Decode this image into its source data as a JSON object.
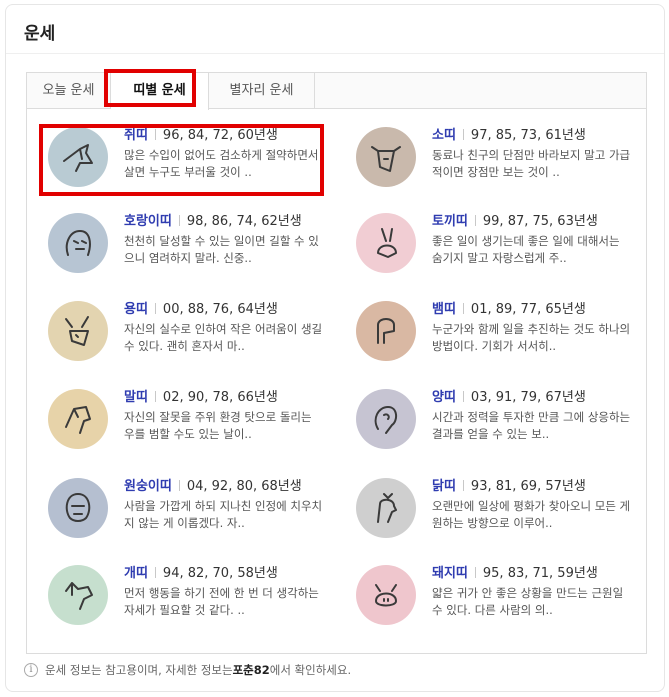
{
  "title": "운세",
  "tabs": [
    {
      "label": "오늘 운세"
    },
    {
      "label": "띠별 운세"
    },
    {
      "label": "별자리 운세"
    }
  ],
  "zodiac": [
    {
      "name": "쥐띠",
      "years": "96, 84, 72, 60년생",
      "desc1": "많은 수입이 없어도 검소하게 절약하면서",
      "desc2": "살면 누구도 부러울 것이 ..",
      "icon": "rat-icon",
      "bg": "#b9cbd3"
    },
    {
      "name": "소띠",
      "years": "97, 85, 73, 61년생",
      "desc1": "동료나 친구의 단점만 바라보지 말고 가급",
      "desc2": "적이면 장점만 보는 것이 ..",
      "icon": "ox-icon",
      "bg": "#c9b9ac"
    },
    {
      "name": "호랑이띠",
      "years": "98, 86, 74, 62년생",
      "desc1": "천천히 달성할 수 있는 일이면 길할 수 있",
      "desc2": "으니 염려하지 말라. 신중..",
      "icon": "tiger-icon",
      "bg": "#b7c5d3"
    },
    {
      "name": "토끼띠",
      "years": "99, 87, 75, 63년생",
      "desc1": "좋은 일이 생기는데 좋은 일에 대해서는",
      "desc2": "숨기지 말고 자랑스럽게 주..",
      "icon": "rabbit-icon",
      "bg": "#f1cdd3"
    },
    {
      "name": "용띠",
      "years": "00, 88, 76, 64년생",
      "desc1": "자신의 실수로 인하여 작은 어려움이 생길",
      "desc2": "수 있다. 괜히 혼자서 마..",
      "icon": "dragon-icon",
      "bg": "#e3d4b0"
    },
    {
      "name": "뱀띠",
      "years": "01, 89, 77, 65년생",
      "desc1": "누군가와 함께 일을 추진하는 것도 하나의",
      "desc2": "방법이다. 기회가 서서히..",
      "icon": "snake-icon",
      "bg": "#d9b8a3"
    },
    {
      "name": "말띠",
      "years": "02, 90, 78, 66년생",
      "desc1": "자신의 잘못을 주위 환경 탓으로 돌리는",
      "desc2": "우를 범할 수도 있는 날이..",
      "icon": "horse-icon",
      "bg": "#e7d3a9"
    },
    {
      "name": "양띠",
      "years": "03, 91, 79, 67년생",
      "desc1": "시간과 정력을 투자한 만큼 그에 상응하는",
      "desc2": "결과를 얻을 수 있는 보..",
      "icon": "sheep-icon",
      "bg": "#c6c4d2"
    },
    {
      "name": "원숭이띠",
      "years": "04, 92, 80, 68년생",
      "desc1": "사람을 가깝게 하되 지나친 인정에 치우치",
      "desc2": "지 않는 게 이롭겠다. 자..",
      "icon": "monkey-icon",
      "bg": "#b5bfd0"
    },
    {
      "name": "닭띠",
      "years": "93, 81, 69, 57년생",
      "desc1": "오랜만에 일상에 평화가 찾아오니 모든 게",
      "desc2": "원하는 방향으로 이루어..",
      "icon": "rooster-icon",
      "bg": "#cfcfcf"
    },
    {
      "name": "개띠",
      "years": "94, 82, 70, 58년생",
      "desc1": "먼저 행동을 하기 전에 한 번 더 생각하는",
      "desc2": "자세가 필요할 것 같다. ..",
      "icon": "dog-icon",
      "bg": "#c6dfce"
    },
    {
      "name": "돼지띠",
      "years": "95, 83, 71, 59년생",
      "desc1": "얇은 귀가 안 좋은 상황을 만드는 근원일",
      "desc2": "수 있다. 다른 사람의 의..",
      "icon": "pig-icon",
      "bg": "#efc6cd"
    }
  ],
  "footer": {
    "text_before": "운세 정보는 참고용이며, 자세한 정보는 ",
    "brand": "포춘82",
    "text_after": "에서 확인하세요."
  },
  "colors": {
    "highlight": "#e10000",
    "zodiac_name": "#2f3cb0"
  }
}
